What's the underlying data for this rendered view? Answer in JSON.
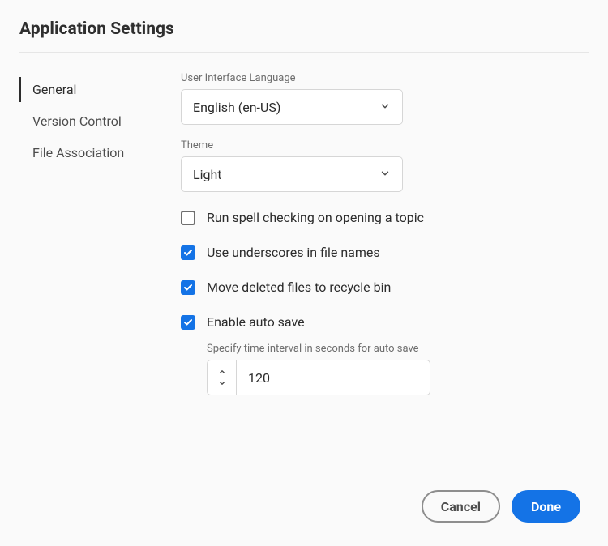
{
  "title": "Application Settings",
  "sidebar": {
    "items": [
      {
        "label": "General",
        "active": true
      },
      {
        "label": "Version Control",
        "active": false
      },
      {
        "label": "File Association",
        "active": false
      }
    ]
  },
  "fields": {
    "language": {
      "label": "User Interface Language",
      "value": "English (en-US)"
    },
    "theme": {
      "label": "Theme",
      "value": "Light"
    }
  },
  "checkboxes": {
    "spellcheck": {
      "label": "Run spell checking on opening a topic",
      "checked": false
    },
    "underscores": {
      "label": "Use underscores in file names",
      "checked": true
    },
    "recycle": {
      "label": "Move deleted files to recycle bin",
      "checked": true
    },
    "autosave": {
      "label": "Enable auto save",
      "checked": true
    }
  },
  "autosave_interval": {
    "label": "Specify time interval in seconds for auto save",
    "value": "120"
  },
  "footer": {
    "cancel": "Cancel",
    "done": "Done"
  }
}
